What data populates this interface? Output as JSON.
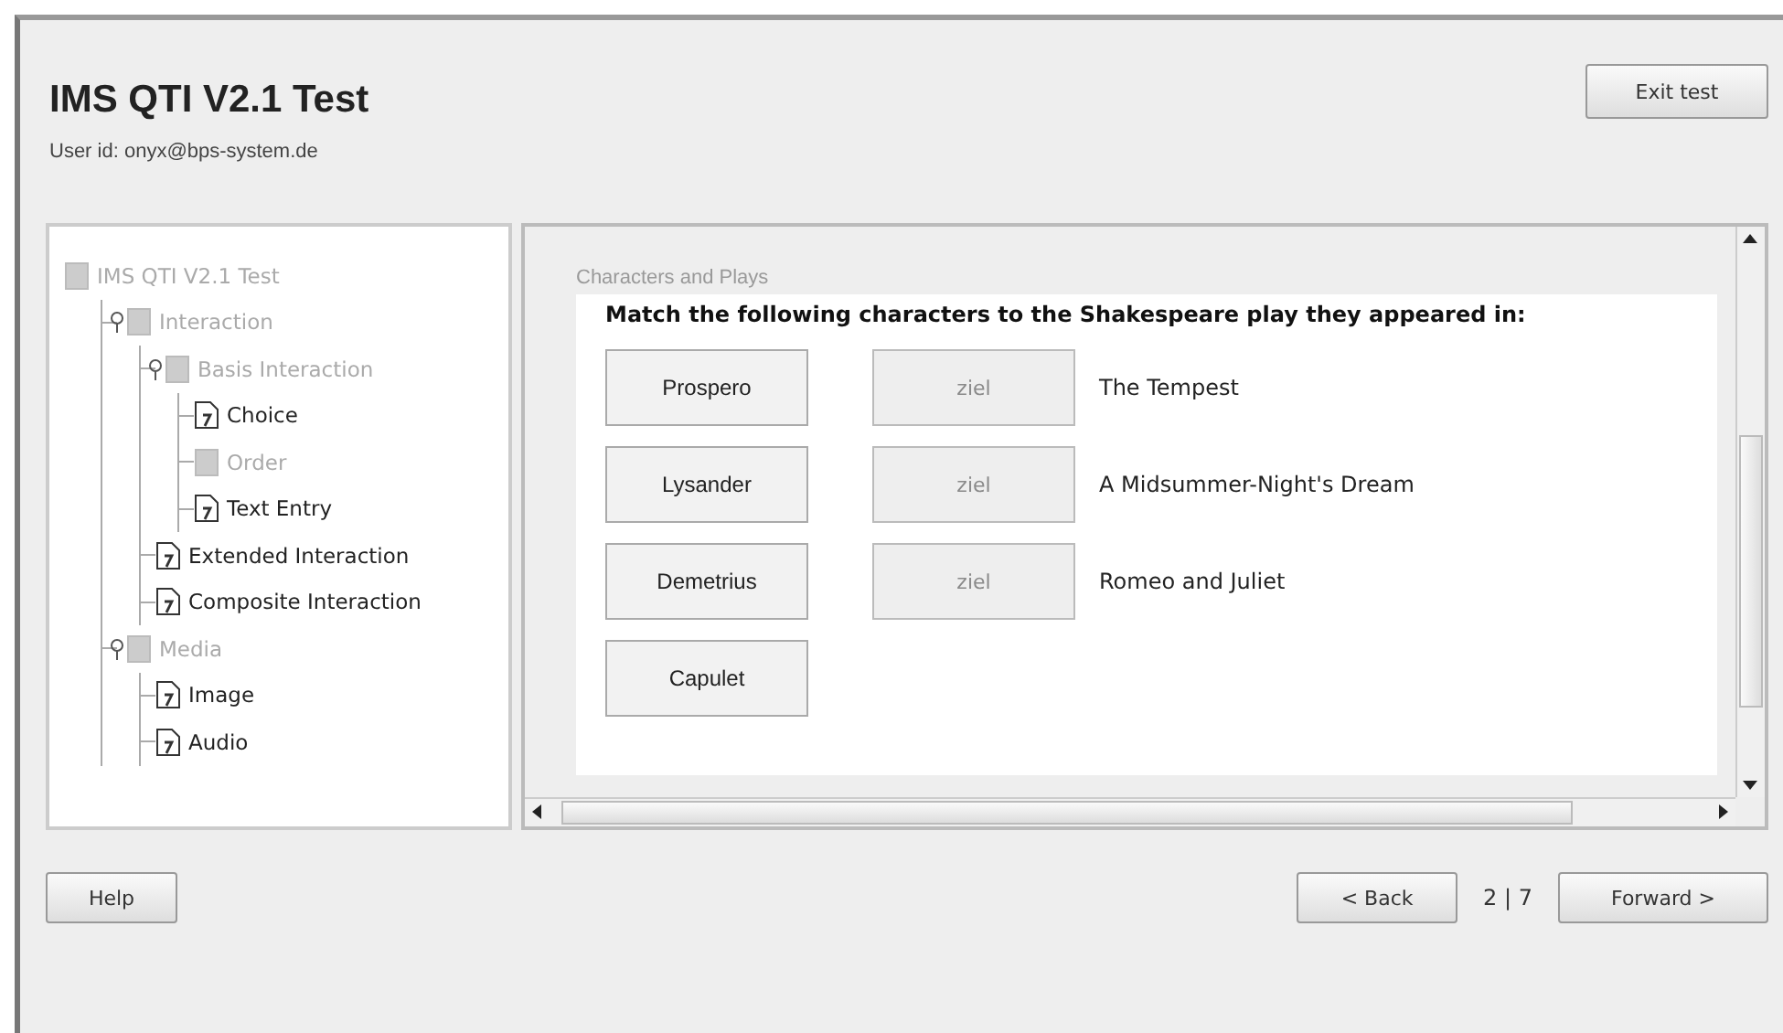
{
  "header": {
    "title": "IMS QTI V2.1 Test",
    "user_id": "User id: onyx@bps-system.de",
    "exit_button": "Exit test"
  },
  "tree": [
    {
      "label": "IMS QTI V2.1 Test",
      "disabled": true,
      "children": [
        {
          "label": "Interaction",
          "disabled": true,
          "expanded": true,
          "children": [
            {
              "label": "Basis Interaction",
              "disabled": true,
              "expanded": true,
              "children": [
                {
                  "label": "Choice",
                  "disabled": false
                },
                {
                  "label": "Order",
                  "disabled": true
                },
                {
                  "label": "Text Entry",
                  "disabled": false
                }
              ]
            },
            {
              "label": "Extended Interaction",
              "disabled": false
            },
            {
              "label": "Composite Interaction",
              "disabled": false
            }
          ]
        },
        {
          "label": "Media",
          "disabled": true,
          "expanded": true,
          "children": [
            {
              "label": "Image",
              "disabled": false
            },
            {
              "label": "Audio",
              "disabled": false
            }
          ]
        }
      ]
    }
  ],
  "content": {
    "section_title": "Characters and Plays",
    "prompt": "Match the following characters to the Shakespeare play they appeared in:",
    "rows": [
      {
        "character": "Prospero",
        "target": "ziel",
        "play": "The Tempest"
      },
      {
        "character": "Lysander",
        "target": "ziel",
        "play": "A Midsummer-Night's Dream"
      },
      {
        "character": "Demetrius",
        "target": "ziel",
        "play": "Romeo and Juliet"
      },
      {
        "character": "Capulet"
      }
    ]
  },
  "footer": {
    "help_button": "Help",
    "back_button": "< Back",
    "page_indicator": "2 | 7",
    "forward_button": "Forward >"
  }
}
